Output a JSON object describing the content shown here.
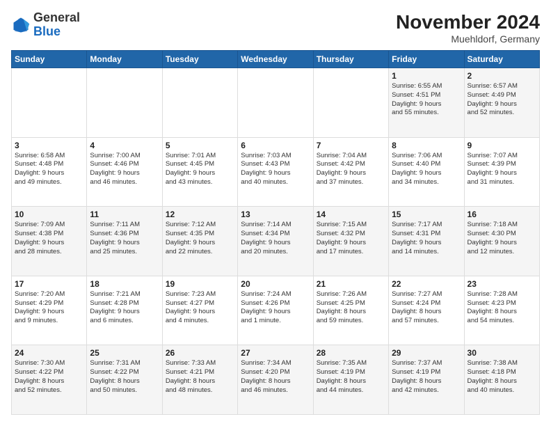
{
  "header": {
    "logo": {
      "general": "General",
      "blue": "Blue"
    },
    "title": "November 2024",
    "location": "Muehldorf, Germany"
  },
  "weekdays": [
    "Sunday",
    "Monday",
    "Tuesday",
    "Wednesday",
    "Thursday",
    "Friday",
    "Saturday"
  ],
  "weeks": [
    [
      {
        "day": "",
        "info": ""
      },
      {
        "day": "",
        "info": ""
      },
      {
        "day": "",
        "info": ""
      },
      {
        "day": "",
        "info": ""
      },
      {
        "day": "",
        "info": ""
      },
      {
        "day": "1",
        "info": "Sunrise: 6:55 AM\nSunset: 4:51 PM\nDaylight: 9 hours\nand 55 minutes."
      },
      {
        "day": "2",
        "info": "Sunrise: 6:57 AM\nSunset: 4:49 PM\nDaylight: 9 hours\nand 52 minutes."
      }
    ],
    [
      {
        "day": "3",
        "info": "Sunrise: 6:58 AM\nSunset: 4:48 PM\nDaylight: 9 hours\nand 49 minutes."
      },
      {
        "day": "4",
        "info": "Sunrise: 7:00 AM\nSunset: 4:46 PM\nDaylight: 9 hours\nand 46 minutes."
      },
      {
        "day": "5",
        "info": "Sunrise: 7:01 AM\nSunset: 4:45 PM\nDaylight: 9 hours\nand 43 minutes."
      },
      {
        "day": "6",
        "info": "Sunrise: 7:03 AM\nSunset: 4:43 PM\nDaylight: 9 hours\nand 40 minutes."
      },
      {
        "day": "7",
        "info": "Sunrise: 7:04 AM\nSunset: 4:42 PM\nDaylight: 9 hours\nand 37 minutes."
      },
      {
        "day": "8",
        "info": "Sunrise: 7:06 AM\nSunset: 4:40 PM\nDaylight: 9 hours\nand 34 minutes."
      },
      {
        "day": "9",
        "info": "Sunrise: 7:07 AM\nSunset: 4:39 PM\nDaylight: 9 hours\nand 31 minutes."
      }
    ],
    [
      {
        "day": "10",
        "info": "Sunrise: 7:09 AM\nSunset: 4:38 PM\nDaylight: 9 hours\nand 28 minutes."
      },
      {
        "day": "11",
        "info": "Sunrise: 7:11 AM\nSunset: 4:36 PM\nDaylight: 9 hours\nand 25 minutes."
      },
      {
        "day": "12",
        "info": "Sunrise: 7:12 AM\nSunset: 4:35 PM\nDaylight: 9 hours\nand 22 minutes."
      },
      {
        "day": "13",
        "info": "Sunrise: 7:14 AM\nSunset: 4:34 PM\nDaylight: 9 hours\nand 20 minutes."
      },
      {
        "day": "14",
        "info": "Sunrise: 7:15 AM\nSunset: 4:32 PM\nDaylight: 9 hours\nand 17 minutes."
      },
      {
        "day": "15",
        "info": "Sunrise: 7:17 AM\nSunset: 4:31 PM\nDaylight: 9 hours\nand 14 minutes."
      },
      {
        "day": "16",
        "info": "Sunrise: 7:18 AM\nSunset: 4:30 PM\nDaylight: 9 hours\nand 12 minutes."
      }
    ],
    [
      {
        "day": "17",
        "info": "Sunrise: 7:20 AM\nSunset: 4:29 PM\nDaylight: 9 hours\nand 9 minutes."
      },
      {
        "day": "18",
        "info": "Sunrise: 7:21 AM\nSunset: 4:28 PM\nDaylight: 9 hours\nand 6 minutes."
      },
      {
        "day": "19",
        "info": "Sunrise: 7:23 AM\nSunset: 4:27 PM\nDaylight: 9 hours\nand 4 minutes."
      },
      {
        "day": "20",
        "info": "Sunrise: 7:24 AM\nSunset: 4:26 PM\nDaylight: 9 hours\nand 1 minute."
      },
      {
        "day": "21",
        "info": "Sunrise: 7:26 AM\nSunset: 4:25 PM\nDaylight: 8 hours\nand 59 minutes."
      },
      {
        "day": "22",
        "info": "Sunrise: 7:27 AM\nSunset: 4:24 PM\nDaylight: 8 hours\nand 57 minutes."
      },
      {
        "day": "23",
        "info": "Sunrise: 7:28 AM\nSunset: 4:23 PM\nDaylight: 8 hours\nand 54 minutes."
      }
    ],
    [
      {
        "day": "24",
        "info": "Sunrise: 7:30 AM\nSunset: 4:22 PM\nDaylight: 8 hours\nand 52 minutes."
      },
      {
        "day": "25",
        "info": "Sunrise: 7:31 AM\nSunset: 4:22 PM\nDaylight: 8 hours\nand 50 minutes."
      },
      {
        "day": "26",
        "info": "Sunrise: 7:33 AM\nSunset: 4:21 PM\nDaylight: 8 hours\nand 48 minutes."
      },
      {
        "day": "27",
        "info": "Sunrise: 7:34 AM\nSunset: 4:20 PM\nDaylight: 8 hours\nand 46 minutes."
      },
      {
        "day": "28",
        "info": "Sunrise: 7:35 AM\nSunset: 4:19 PM\nDaylight: 8 hours\nand 44 minutes."
      },
      {
        "day": "29",
        "info": "Sunrise: 7:37 AM\nSunset: 4:19 PM\nDaylight: 8 hours\nand 42 minutes."
      },
      {
        "day": "30",
        "info": "Sunrise: 7:38 AM\nSunset: 4:18 PM\nDaylight: 8 hours\nand 40 minutes."
      }
    ]
  ]
}
